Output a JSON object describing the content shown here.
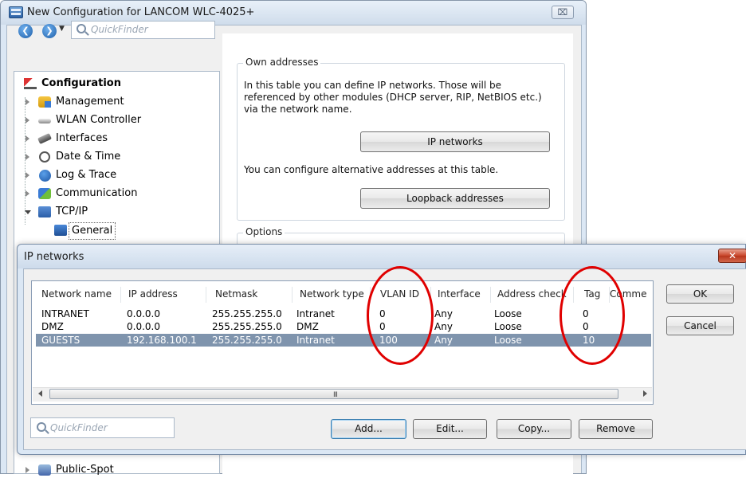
{
  "main_window": {
    "title": "New Configuration for LANCOM WLC-4025+",
    "close_label": "⌧",
    "quickfinder_placeholder": "QuickFinder",
    "tree": [
      {
        "label": "Configuration",
        "icon": "configuration-icon"
      },
      {
        "label": "Management",
        "icon": "management-icon"
      },
      {
        "label": "WLAN Controller",
        "icon": "wlan-controller-icon"
      },
      {
        "label": "Interfaces",
        "icon": "interfaces-icon"
      },
      {
        "label": "Date & Time",
        "icon": "clock-icon"
      },
      {
        "label": "Log & Trace",
        "icon": "info-icon"
      },
      {
        "label": "Communication",
        "icon": "communication-icon"
      },
      {
        "label": "TCP/IP",
        "icon": "network-icon"
      },
      {
        "label": "General",
        "icon": "network-general-icon"
      },
      {
        "label": "Public-Spot",
        "icon": "public-spot-icon"
      }
    ],
    "own_addresses": {
      "title": "Own addresses",
      "desc1_line1": "In this table you can define IP networks. Those will be",
      "desc1_line2": "referenced by other modules (DHCP server, RIP, NetBIOS etc.)",
      "desc1_line3": "via the network name.",
      "ip_networks_button": "IP networks",
      "desc2": "You can configure alternative addresses at this table.",
      "loopback_button": "Loopback addresses"
    },
    "options_title": "Options"
  },
  "dialog": {
    "title": "IP networks",
    "columns": [
      "Network name",
      "IP address",
      "Netmask",
      "Network type",
      "VLAN ID",
      "Interface",
      "Address check",
      "Tag",
      "Comme"
    ],
    "rows": [
      {
        "name": "INTRANET",
        "ip": "0.0.0.0",
        "netmask": "255.255.255.0",
        "type": "Intranet",
        "vlan": "0",
        "iface": "Any",
        "check": "Loose",
        "tag": "0"
      },
      {
        "name": "DMZ",
        "ip": "0.0.0.0",
        "netmask": "255.255.255.0",
        "type": "DMZ",
        "vlan": "0",
        "iface": "Any",
        "check": "Loose",
        "tag": "0"
      },
      {
        "name": "GUESTS",
        "ip": "192.168.100.1",
        "netmask": "255.255.255.0",
        "type": "Intranet",
        "vlan": "100",
        "iface": "Any",
        "check": "Loose",
        "tag": "10"
      }
    ],
    "selected_row": 2,
    "scroll_grip": "III",
    "ok_label": "OK",
    "cancel_label": "Cancel",
    "quickfinder_placeholder": "QuickFinder",
    "add_label": "Add...",
    "edit_label": "Edit...",
    "copy_label": "Copy...",
    "remove_label": "Remove",
    "close_label": "✕"
  },
  "colors": {
    "selection": "#7f94ad",
    "highlight_ellipse": "#e00000",
    "frame": "#dbe7f4"
  }
}
